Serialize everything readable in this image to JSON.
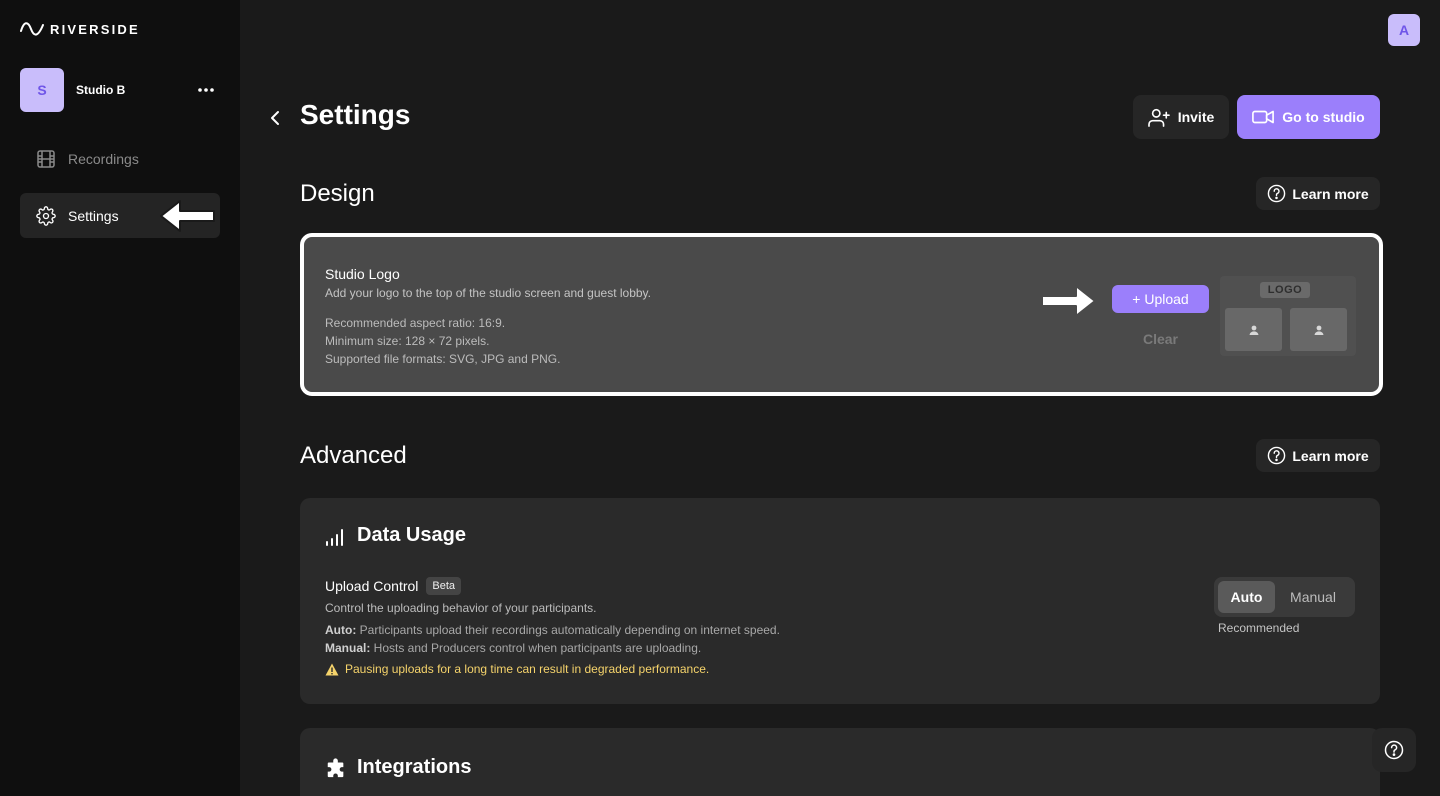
{
  "brand": {
    "name": "RIVERSIDE"
  },
  "studio": {
    "avatar_letter": "S",
    "name": "Studio B",
    "more_icon": "more-horizontal-icon"
  },
  "sidebar": {
    "items": [
      {
        "label": "Recordings",
        "icon": "film-icon"
      },
      {
        "label": "Settings",
        "icon": "gear-icon"
      }
    ]
  },
  "user": {
    "avatar_letter": "A"
  },
  "header": {
    "title": "Settings",
    "invite_label": "Invite",
    "go_to_studio_label": "Go to studio"
  },
  "design": {
    "title": "Design",
    "learn_more": "Learn more",
    "studio_logo": {
      "title": "Studio Logo",
      "description": "Add your logo to the top of the studio screen and guest lobby.",
      "aspect": "Recommended aspect ratio: 16:9.",
      "min_size": "Minimum size: 128 × 72 pixels.",
      "formats": "Supported file formats: SVG, JPG and PNG.",
      "upload_label": "+ Upload",
      "clear_label": "Clear",
      "preview_tag": "LOGO"
    }
  },
  "advanced": {
    "title": "Advanced",
    "learn_more": "Learn more",
    "data_usage": {
      "title": "Data Usage",
      "upload_control": "Upload Control",
      "beta": "Beta",
      "description": "Control the uploading behavior of your participants.",
      "auto_label": "Auto:",
      "auto_desc": " Participants upload their recordings automatically depending on internet speed.",
      "manual_label": "Manual:",
      "manual_desc": " Hosts and Producers control when participants are uploading.",
      "warning": "Pausing uploads for a long time can result in degraded performance.",
      "seg_auto": "Auto",
      "seg_manual": "Manual",
      "recommended": "Recommended"
    },
    "integrations": {
      "title": "Integrations"
    }
  },
  "colors": {
    "accent": "#9b7ffb",
    "avatar_bg": "#c9bdfb",
    "warning": "#f5d36b"
  }
}
